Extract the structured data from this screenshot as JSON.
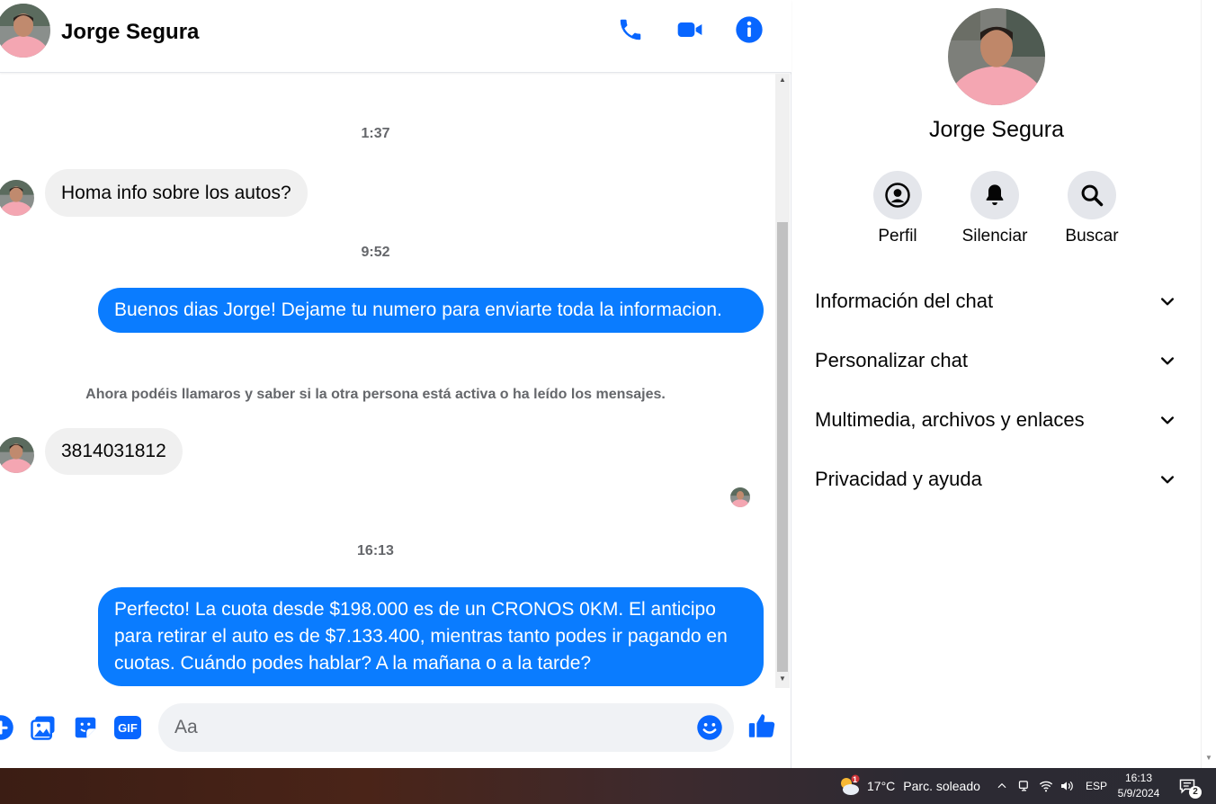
{
  "header": {
    "name": "Jorge Segura"
  },
  "messages": {
    "time1": "1:37",
    "incoming1": "Homa info sobre los autos?",
    "time2": "9:52",
    "outgoing1": "Buenos dias Jorge! Dejame tu numero para enviarte toda la informacion.",
    "system": "Ahora podéis llamaros y saber si la otra persona está activa o ha leído los mensajes.",
    "incoming2": "3814031812",
    "time3": "16:13",
    "outgoing2": "Perfecto! La cuota desde $198.000 es de un CRONOS 0KM. El anticipo para retirar el auto es de $7.133.400, mientras tanto podes ir pagando en cuotas. Cuándo podes hablar? A la mañana o a la tarde?"
  },
  "composer": {
    "placeholder": "Aa",
    "gif_label": "GIF"
  },
  "info_panel": {
    "name": "Jorge Segura",
    "actions": [
      {
        "label": "Perfil",
        "icon": "profile-icon"
      },
      {
        "label": "Silenciar",
        "icon": "bell-icon"
      },
      {
        "label": "Buscar",
        "icon": "search-icon"
      }
    ],
    "sections": [
      {
        "label": "Información del chat"
      },
      {
        "label": "Personalizar chat"
      },
      {
        "label": "Multimedia, archivos y enlaces"
      },
      {
        "label": "Privacidad y ayuda"
      }
    ]
  },
  "taskbar": {
    "weather_temp": "17°C",
    "weather_desc": "Parc. soleado",
    "weather_badge": "1",
    "language": "ESP",
    "time": "16:13",
    "date": "5/9/2024",
    "notification_count": "2"
  },
  "colors": {
    "accent": "#0a7cff",
    "icon_blue": "#0866ff",
    "incoming_bubble": "#f0f0f0"
  }
}
